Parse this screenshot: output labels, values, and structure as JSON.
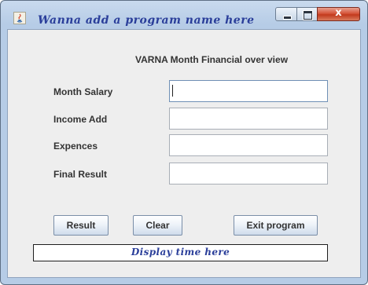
{
  "window": {
    "title": "Wanna add a program name here",
    "controls": {
      "minimize_icon": "minimize-icon",
      "maximize_icon": "maximize-icon",
      "close_icon": "close-icon",
      "close_glyph": "x"
    },
    "app_icon": "java-icon"
  },
  "form": {
    "heading": "VARNA Month Financial over view",
    "fields": [
      {
        "label": "Month Salary",
        "value": ""
      },
      {
        "label": "Income Add",
        "value": ""
      },
      {
        "label": "Expences",
        "value": ""
      },
      {
        "label": "Final Result",
        "value": ""
      }
    ]
  },
  "buttons": {
    "result": "Result",
    "clear": "Clear",
    "exit": "Exit program"
  },
  "status": {
    "text": "Display time here"
  },
  "colors": {
    "title_text": "#2a3e9a",
    "close_button": "#c23a1d",
    "panel_background": "#eeeeee",
    "frame": "#b6cce6"
  }
}
